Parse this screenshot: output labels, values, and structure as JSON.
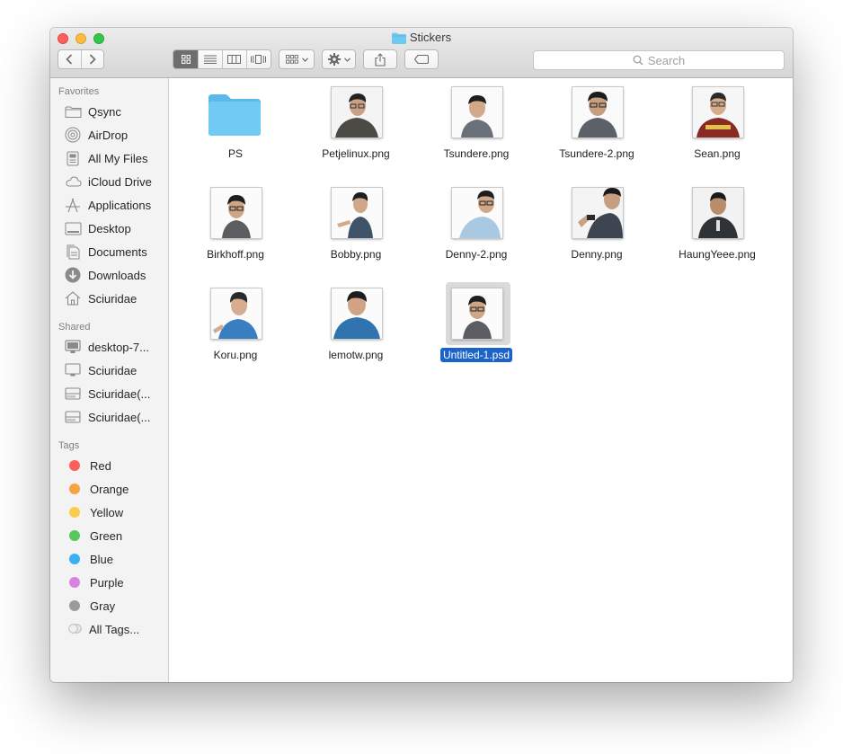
{
  "window": {
    "title": "Stickers"
  },
  "toolbar": {
    "back_icon": "chevron-left-icon",
    "forward_icon": "chevron-right-icon",
    "view_modes": [
      "icon-view-icon",
      "list-view-icon",
      "column-view-icon",
      "cover-flow-icon"
    ],
    "active_view": "icon-view-icon",
    "arrange_icon": "arrange-grid-icon",
    "action_icon": "gear-icon",
    "share_icon": "share-icon",
    "tag_icon": "tag-icon",
    "search_placeholder": "Search"
  },
  "sidebar": {
    "favorites_label": "Favorites",
    "favorites": [
      {
        "label": "Qsync",
        "icon": "folder-icon"
      },
      {
        "label": "AirDrop",
        "icon": "airdrop-icon"
      },
      {
        "label": "All My Files",
        "icon": "all-files-icon"
      },
      {
        "label": "iCloud Drive",
        "icon": "cloud-icon"
      },
      {
        "label": "Applications",
        "icon": "applications-icon"
      },
      {
        "label": "Desktop",
        "icon": "desktop-icon"
      },
      {
        "label": "Documents",
        "icon": "documents-icon"
      },
      {
        "label": "Downloads",
        "icon": "downloads-icon"
      },
      {
        "label": "Sciuridae",
        "icon": "home-icon"
      }
    ],
    "shared_label": "Shared",
    "shared": [
      {
        "label": "desktop-7...",
        "icon": "monitor-icon"
      },
      {
        "label": "Sciuridae",
        "icon": "monitor-icon"
      },
      {
        "label": "Sciuridae(...",
        "icon": "server-icon"
      },
      {
        "label": "Sciuridae(...",
        "icon": "server-icon"
      }
    ],
    "tags_label": "Tags",
    "tags": [
      {
        "label": "Red",
        "color": "#fc5f5c"
      },
      {
        "label": "Orange",
        "color": "#f7a343"
      },
      {
        "label": "Yellow",
        "color": "#f9cc4e"
      },
      {
        "label": "Green",
        "color": "#5ac75a"
      },
      {
        "label": "Blue",
        "color": "#3ab0f0"
      },
      {
        "label": "Purple",
        "color": "#d883e0"
      },
      {
        "label": "Gray",
        "color": "#9a9a9a"
      }
    ],
    "all_tags_label": "All Tags..."
  },
  "files": [
    {
      "name": "PS",
      "kind": "folder"
    },
    {
      "name": "Petjelinux.png",
      "kind": "image"
    },
    {
      "name": "Tsundere.png",
      "kind": "image"
    },
    {
      "name": "Tsundere-2.png",
      "kind": "image"
    },
    {
      "name": "Sean.png",
      "kind": "image"
    },
    {
      "name": "Birkhoff.png",
      "kind": "image"
    },
    {
      "name": "Bobby.png",
      "kind": "image"
    },
    {
      "name": "Denny-2.png",
      "kind": "image"
    },
    {
      "name": "Denny.png",
      "kind": "image"
    },
    {
      "name": "HaungYeee.png",
      "kind": "image"
    },
    {
      "name": "Koru.png",
      "kind": "image"
    },
    {
      "name": "lemotw.png",
      "kind": "image"
    },
    {
      "name": "Untitled-1.psd",
      "kind": "image",
      "selected": true
    }
  ],
  "colors": {
    "selection": "#1b63c9",
    "folder": "#6ec9f3"
  }
}
